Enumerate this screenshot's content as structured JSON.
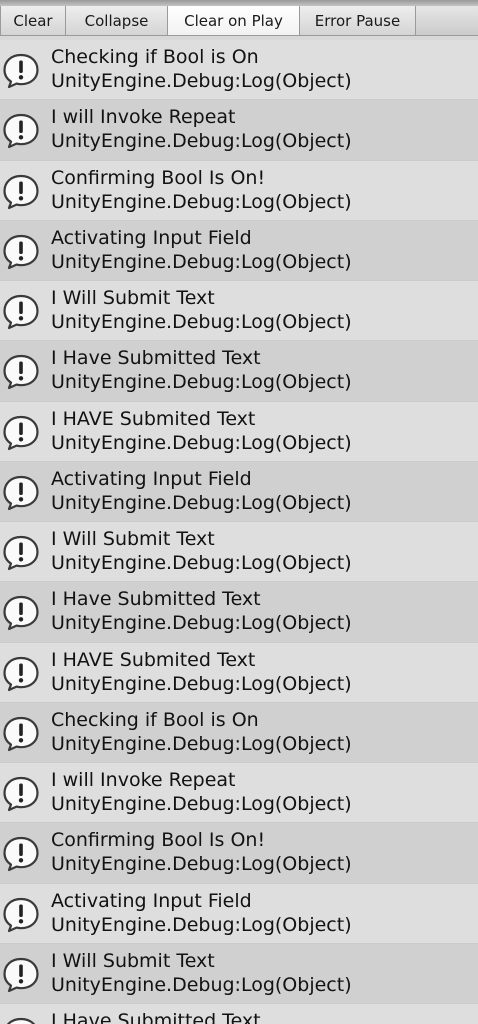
{
  "toolbar": {
    "buttons": [
      {
        "label": "Clear",
        "active": false
      },
      {
        "label": "Collapse",
        "active": false
      },
      {
        "label": "Clear on Play",
        "active": true
      },
      {
        "label": "Error Pause",
        "active": false
      }
    ]
  },
  "log": {
    "entries": [
      {
        "message": "Checking if Bool is On",
        "source": "UnityEngine.Debug:Log(Object)",
        "icon": "info-speech-bubble-icon"
      },
      {
        "message": "I will Invoke Repeat",
        "source": "UnityEngine.Debug:Log(Object)",
        "icon": "info-speech-bubble-icon"
      },
      {
        "message": "Confirming Bool Is On!",
        "source": "UnityEngine.Debug:Log(Object)",
        "icon": "info-speech-bubble-icon"
      },
      {
        "message": "Activating Input Field",
        "source": "UnityEngine.Debug:Log(Object)",
        "icon": "info-speech-bubble-icon"
      },
      {
        "message": "I Will Submit Text",
        "source": "UnityEngine.Debug:Log(Object)",
        "icon": "info-speech-bubble-icon"
      },
      {
        "message": "I Have Submitted Text",
        "source": "UnityEngine.Debug:Log(Object)",
        "icon": "info-speech-bubble-icon"
      },
      {
        "message": "I HAVE Submited Text",
        "source": "UnityEngine.Debug:Log(Object)",
        "icon": "info-speech-bubble-icon"
      },
      {
        "message": "Activating Input Field",
        "source": "UnityEngine.Debug:Log(Object)",
        "icon": "info-speech-bubble-icon"
      },
      {
        "message": "I Will Submit Text",
        "source": "UnityEngine.Debug:Log(Object)",
        "icon": "info-speech-bubble-icon"
      },
      {
        "message": "I Have Submitted Text",
        "source": "UnityEngine.Debug:Log(Object)",
        "icon": "info-speech-bubble-icon"
      },
      {
        "message": "I HAVE Submited Text",
        "source": "UnityEngine.Debug:Log(Object)",
        "icon": "info-speech-bubble-icon"
      },
      {
        "message": "Checking if Bool is On",
        "source": "UnityEngine.Debug:Log(Object)",
        "icon": "info-speech-bubble-icon"
      },
      {
        "message": "I will Invoke Repeat",
        "source": "UnityEngine.Debug:Log(Object)",
        "icon": "info-speech-bubble-icon"
      },
      {
        "message": "Confirming Bool Is On!",
        "source": "UnityEngine.Debug:Log(Object)",
        "icon": "info-speech-bubble-icon"
      },
      {
        "message": "Activating Input Field",
        "source": "UnityEngine.Debug:Log(Object)",
        "icon": "info-speech-bubble-icon"
      },
      {
        "message": "I Will Submit Text",
        "source": "UnityEngine.Debug:Log(Object)",
        "icon": "info-speech-bubble-icon"
      },
      {
        "message": "I Have Submitted Text",
        "source": "",
        "icon": "info-speech-bubble-icon"
      }
    ]
  }
}
